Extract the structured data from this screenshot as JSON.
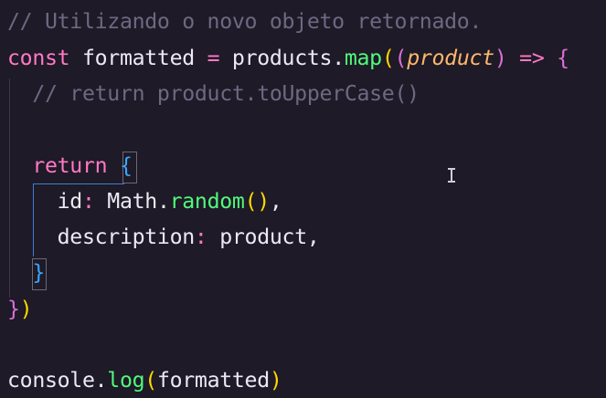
{
  "editor": {
    "lines": [
      {
        "tokens": [
          {
            "t": "// Utilizando o novo objeto retornado.",
            "c": "comment"
          }
        ]
      },
      {
        "tokens": [
          {
            "t": "const",
            "c": "kw"
          },
          {
            "t": " formatted ",
            "c": "plain"
          },
          {
            "t": "=",
            "c": "op"
          },
          {
            "t": " products.",
            "c": "plain"
          },
          {
            "t": "map",
            "c": "fn"
          },
          {
            "t": "(",
            "c": "b1"
          },
          {
            "t": "(",
            "c": "b2"
          },
          {
            "t": "product",
            "c": "param"
          },
          {
            "t": ")",
            "c": "b2"
          },
          {
            "t": " ",
            "c": "plain"
          },
          {
            "t": "=>",
            "c": "kw"
          },
          {
            "t": " ",
            "c": "plain"
          },
          {
            "t": "{",
            "c": "b2"
          }
        ]
      },
      {
        "tokens": [
          {
            "t": "  // return product.toUpperCase()",
            "c": "comment"
          }
        ]
      },
      {
        "tokens": []
      },
      {
        "tokens": [
          {
            "t": "  ",
            "c": "plain"
          },
          {
            "t": "return",
            "c": "kw"
          },
          {
            "t": " ",
            "c": "plain"
          },
          {
            "t": "{",
            "c": "b3"
          }
        ]
      },
      {
        "tokens": [
          {
            "t": "    id",
            "c": "prop"
          },
          {
            "t": ":",
            "c": "kw"
          },
          {
            "t": " Math.",
            "c": "plain"
          },
          {
            "t": "random",
            "c": "fn"
          },
          {
            "t": "()",
            "c": "b1"
          },
          {
            "t": ",",
            "c": "plain"
          }
        ]
      },
      {
        "tokens": [
          {
            "t": "    description",
            "c": "prop"
          },
          {
            "t": ":",
            "c": "kw"
          },
          {
            "t": " product,",
            "c": "plain"
          }
        ]
      },
      {
        "tokens": [
          {
            "t": "  ",
            "c": "plain"
          },
          {
            "t": "}",
            "c": "b3"
          }
        ]
      },
      {
        "tokens": [
          {
            "t": "}",
            "c": "b2"
          },
          {
            "t": ")",
            "c": "b1"
          }
        ]
      },
      {
        "tokens": []
      },
      {
        "tokens": [
          {
            "t": "console.",
            "c": "plain"
          },
          {
            "t": "log",
            "c": "fn"
          },
          {
            "t": "(",
            "c": "b1"
          },
          {
            "t": "formatted",
            "c": "plain"
          },
          {
            "t": ")",
            "c": "b1"
          }
        ]
      }
    ]
  },
  "colors": {
    "background": "#1e1a27",
    "comment": "#6d6982",
    "keyword": "#ff79c6",
    "function": "#50fa7b",
    "parameter": "#ffb86c",
    "bracket_level1": "#ffd700",
    "bracket_level2": "#da70d6",
    "bracket_level3": "#3aa6ff"
  },
  "cursor": {
    "type": "i-beam-icon"
  }
}
